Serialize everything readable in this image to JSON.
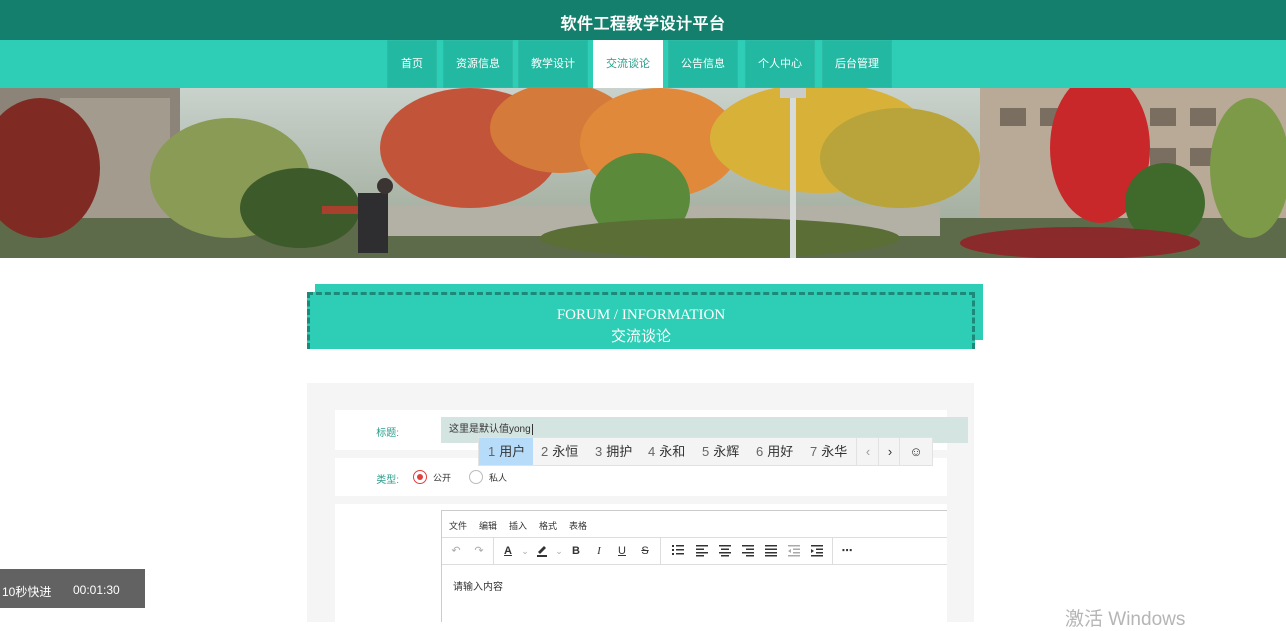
{
  "header": {
    "title": "软件工程教学设计平台"
  },
  "nav": {
    "items": [
      {
        "label": "首页"
      },
      {
        "label": "资源信息"
      },
      {
        "label": "教学设计"
      },
      {
        "label": "交流谈论",
        "active": true
      },
      {
        "label": "公告信息"
      },
      {
        "label": "个人中心"
      },
      {
        "label": "后台管理"
      }
    ]
  },
  "carousel": {
    "slide_count": 3,
    "active_index": 1
  },
  "section": {
    "title_en": "FORUM / INFORMATION",
    "title_cn": "交流谈论"
  },
  "form": {
    "title_label": "标题:",
    "title_value": "这里是默认值yong",
    "type_label": "类型:",
    "type_options": [
      {
        "label": "公开",
        "checked": true
      },
      {
        "label": "私人",
        "checked": false
      }
    ],
    "editor": {
      "menu": [
        "文件",
        "编辑",
        "插入",
        "格式",
        "表格"
      ],
      "toolbar_icons": [
        "undo-icon",
        "redo-icon",
        "text-color-icon",
        "highlight-icon",
        "bold-icon",
        "italic-icon",
        "underline-icon",
        "strikethrough-icon",
        "list-icon",
        "align-left-icon",
        "align-center-icon",
        "align-right-icon",
        "align-justify-icon",
        "outdent-icon",
        "indent-icon",
        "more-icon"
      ],
      "toolbar_glyphs": {
        "undo": "↶",
        "redo": "↷",
        "text_color": "A",
        "bold": "B",
        "italic": "I",
        "underline": "U",
        "strike": "S",
        "more": "⋯",
        "caret": "⌄"
      },
      "placeholder": "请输入内容"
    }
  },
  "ime": {
    "candidates": [
      {
        "num": "1",
        "text": "用户",
        "selected": true
      },
      {
        "num": "2",
        "text": "永恒"
      },
      {
        "num": "3",
        "text": "拥护"
      },
      {
        "num": "4",
        "text": "永和"
      },
      {
        "num": "5",
        "text": "永辉"
      },
      {
        "num": "6",
        "text": "用好"
      },
      {
        "num": "7",
        "text": "永华"
      }
    ],
    "prev": "‹",
    "next": "›",
    "emoji": "☺"
  },
  "video": {
    "skip_label": "10秒快进",
    "time": "00:01:30"
  },
  "watermark": "激活 Windows",
  "colors": {
    "header": "#147f6c",
    "accent": "#2dceb5",
    "nav_item": "#23b8a1",
    "radio_checked": "#e04040",
    "ime_selected": "#b7dcfa"
  }
}
